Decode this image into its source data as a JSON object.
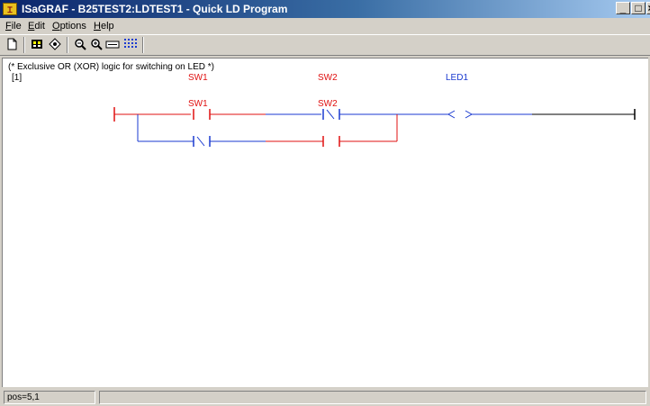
{
  "window": {
    "title": "ISaGRAF - B25TEST2:LDTEST1 - Quick LD Program",
    "icon": "isagraf-app-icon",
    "controls": {
      "minimize": "_",
      "maximize": "□",
      "close": "×"
    }
  },
  "menu": {
    "file": "File",
    "edit": "Edit",
    "options": "Options",
    "help": "Help"
  },
  "toolbar": {
    "icons": [
      "new-document-icon",
      "dictionary-icon",
      "variables-icon",
      "zoom-out-icon",
      "zoom-in-icon",
      "fit-width-icon",
      "grid-icon"
    ]
  },
  "program": {
    "comment": "(* Exclusive OR (XOR) logic for switching on LED *)",
    "rung_number": "[1]",
    "contacts": [
      {
        "label": "SW1",
        "type": "normally-open",
        "state": "active"
      },
      {
        "label": "SW2",
        "type": "normally-closed",
        "state": "inactive"
      },
      {
        "label": "SW1",
        "type": "normally-closed",
        "state": "inactive"
      },
      {
        "label": "SW2",
        "type": "normally-open",
        "state": "active"
      }
    ],
    "coil": {
      "label": "LED1",
      "state": "inactive"
    },
    "colors": {
      "active": "#e01010",
      "inactive": "#1a3ad0",
      "rail": "#000000"
    }
  },
  "status": {
    "position": "pos=5,1"
  }
}
